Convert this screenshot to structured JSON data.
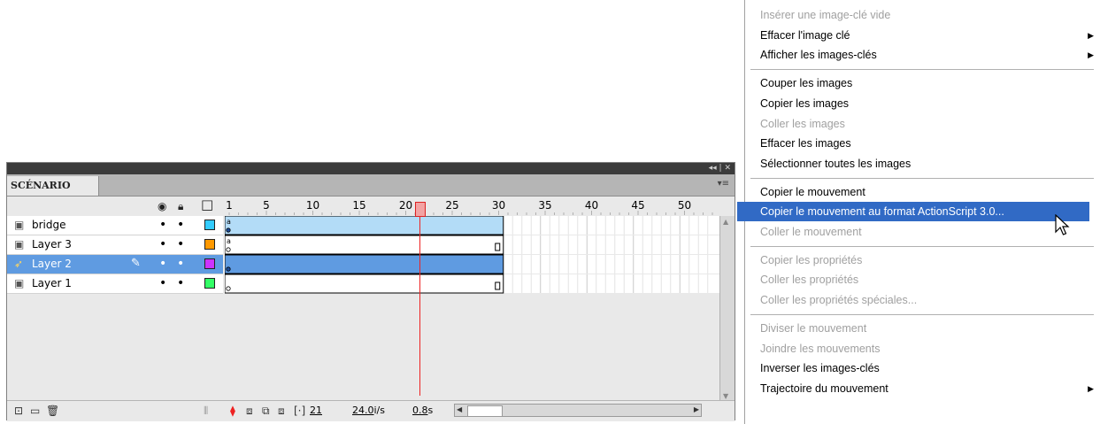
{
  "timeline": {
    "tab_label": "SCÉNARIO",
    "panel_controls": "◂◂ | ✕",
    "panel_menu": "▾≡",
    "ruler": [
      "1",
      "5",
      "10",
      "15",
      "20",
      "25",
      "30",
      "35",
      "40",
      "45",
      "50"
    ],
    "current_frame": "21",
    "frame_rate": "24.0",
    "frame_rate_unit": "i/s",
    "elapsed_time": "0.8",
    "elapsed_unit": "s",
    "layers": [
      {
        "name": "bridge",
        "color": "#33ccff",
        "selected": false
      },
      {
        "name": "Layer 3",
        "color": "#ff9900",
        "selected": false
      },
      {
        "name": "Layer 2",
        "color": "#cc33ff",
        "selected": true
      },
      {
        "name": "Layer 1",
        "color": "#33ff66",
        "selected": false
      }
    ]
  },
  "context_menu": {
    "items": [
      {
        "label": "Insérer une image-clé vide",
        "disabled": true,
        "submenu": false
      },
      {
        "label": "Effacer l'image clé",
        "disabled": false,
        "submenu": true
      },
      {
        "label": "Afficher les images-clés",
        "disabled": false,
        "submenu": true
      },
      {
        "separator": true
      },
      {
        "label": "Couper les images",
        "disabled": false,
        "submenu": false
      },
      {
        "label": "Copier les images",
        "disabled": false,
        "submenu": false
      },
      {
        "label": "Coller les images",
        "disabled": true,
        "submenu": false
      },
      {
        "label": "Effacer les images",
        "disabled": false,
        "submenu": false
      },
      {
        "label": "Sélectionner toutes les images",
        "disabled": false,
        "submenu": false
      },
      {
        "separator": true
      },
      {
        "label": "Copier le mouvement",
        "disabled": false,
        "submenu": false
      },
      {
        "label": "Copier le mouvement au format ActionScript 3.0...",
        "disabled": false,
        "submenu": false,
        "highlighted": true
      },
      {
        "label": "Coller le mouvement",
        "disabled": true,
        "submenu": false
      },
      {
        "separator": true
      },
      {
        "label": "Copier les propriétés",
        "disabled": true,
        "submenu": false
      },
      {
        "label": "Coller les propriétés",
        "disabled": true,
        "submenu": false
      },
      {
        "label": "Coller les propriétés spéciales...",
        "disabled": true,
        "submenu": false
      },
      {
        "separator": true
      },
      {
        "label": "Diviser le mouvement",
        "disabled": true,
        "submenu": false
      },
      {
        "label": "Joindre les mouvements",
        "disabled": true,
        "submenu": false
      },
      {
        "label": "Inverser les images-clés",
        "disabled": false,
        "submenu": false
      },
      {
        "label": "Trajectoire du mouvement",
        "disabled": false,
        "submenu": true
      }
    ]
  }
}
